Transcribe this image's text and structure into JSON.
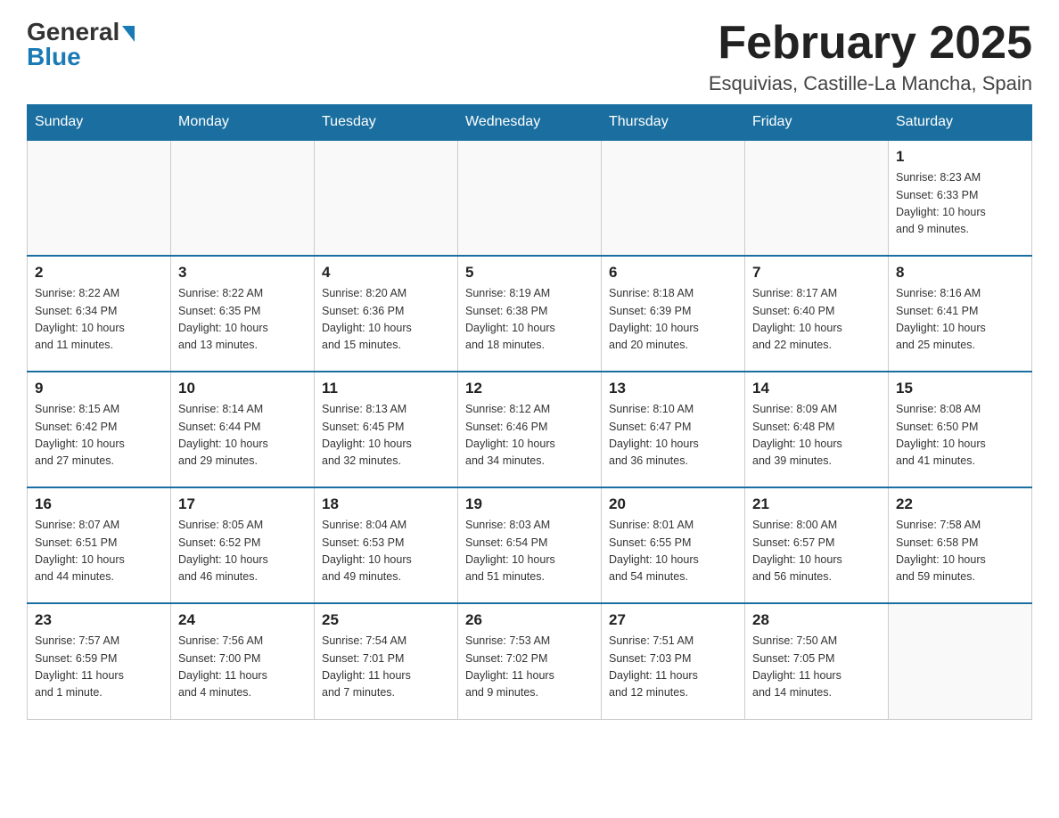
{
  "header": {
    "logo_general": "General",
    "logo_blue": "Blue",
    "month_title": "February 2025",
    "location": "Esquivias, Castille-La Mancha, Spain"
  },
  "weekdays": [
    "Sunday",
    "Monday",
    "Tuesday",
    "Wednesday",
    "Thursday",
    "Friday",
    "Saturday"
  ],
  "weeks": [
    [
      {
        "day": "",
        "info": ""
      },
      {
        "day": "",
        "info": ""
      },
      {
        "day": "",
        "info": ""
      },
      {
        "day": "",
        "info": ""
      },
      {
        "day": "",
        "info": ""
      },
      {
        "day": "",
        "info": ""
      },
      {
        "day": "1",
        "info": "Sunrise: 8:23 AM\nSunset: 6:33 PM\nDaylight: 10 hours\nand 9 minutes."
      }
    ],
    [
      {
        "day": "2",
        "info": "Sunrise: 8:22 AM\nSunset: 6:34 PM\nDaylight: 10 hours\nand 11 minutes."
      },
      {
        "day": "3",
        "info": "Sunrise: 8:22 AM\nSunset: 6:35 PM\nDaylight: 10 hours\nand 13 minutes."
      },
      {
        "day": "4",
        "info": "Sunrise: 8:20 AM\nSunset: 6:36 PM\nDaylight: 10 hours\nand 15 minutes."
      },
      {
        "day": "5",
        "info": "Sunrise: 8:19 AM\nSunset: 6:38 PM\nDaylight: 10 hours\nand 18 minutes."
      },
      {
        "day": "6",
        "info": "Sunrise: 8:18 AM\nSunset: 6:39 PM\nDaylight: 10 hours\nand 20 minutes."
      },
      {
        "day": "7",
        "info": "Sunrise: 8:17 AM\nSunset: 6:40 PM\nDaylight: 10 hours\nand 22 minutes."
      },
      {
        "day": "8",
        "info": "Sunrise: 8:16 AM\nSunset: 6:41 PM\nDaylight: 10 hours\nand 25 minutes."
      }
    ],
    [
      {
        "day": "9",
        "info": "Sunrise: 8:15 AM\nSunset: 6:42 PM\nDaylight: 10 hours\nand 27 minutes."
      },
      {
        "day": "10",
        "info": "Sunrise: 8:14 AM\nSunset: 6:44 PM\nDaylight: 10 hours\nand 29 minutes."
      },
      {
        "day": "11",
        "info": "Sunrise: 8:13 AM\nSunset: 6:45 PM\nDaylight: 10 hours\nand 32 minutes."
      },
      {
        "day": "12",
        "info": "Sunrise: 8:12 AM\nSunset: 6:46 PM\nDaylight: 10 hours\nand 34 minutes."
      },
      {
        "day": "13",
        "info": "Sunrise: 8:10 AM\nSunset: 6:47 PM\nDaylight: 10 hours\nand 36 minutes."
      },
      {
        "day": "14",
        "info": "Sunrise: 8:09 AM\nSunset: 6:48 PM\nDaylight: 10 hours\nand 39 minutes."
      },
      {
        "day": "15",
        "info": "Sunrise: 8:08 AM\nSunset: 6:50 PM\nDaylight: 10 hours\nand 41 minutes."
      }
    ],
    [
      {
        "day": "16",
        "info": "Sunrise: 8:07 AM\nSunset: 6:51 PM\nDaylight: 10 hours\nand 44 minutes."
      },
      {
        "day": "17",
        "info": "Sunrise: 8:05 AM\nSunset: 6:52 PM\nDaylight: 10 hours\nand 46 minutes."
      },
      {
        "day": "18",
        "info": "Sunrise: 8:04 AM\nSunset: 6:53 PM\nDaylight: 10 hours\nand 49 minutes."
      },
      {
        "day": "19",
        "info": "Sunrise: 8:03 AM\nSunset: 6:54 PM\nDaylight: 10 hours\nand 51 minutes."
      },
      {
        "day": "20",
        "info": "Sunrise: 8:01 AM\nSunset: 6:55 PM\nDaylight: 10 hours\nand 54 minutes."
      },
      {
        "day": "21",
        "info": "Sunrise: 8:00 AM\nSunset: 6:57 PM\nDaylight: 10 hours\nand 56 minutes."
      },
      {
        "day": "22",
        "info": "Sunrise: 7:58 AM\nSunset: 6:58 PM\nDaylight: 10 hours\nand 59 minutes."
      }
    ],
    [
      {
        "day": "23",
        "info": "Sunrise: 7:57 AM\nSunset: 6:59 PM\nDaylight: 11 hours\nand 1 minute."
      },
      {
        "day": "24",
        "info": "Sunrise: 7:56 AM\nSunset: 7:00 PM\nDaylight: 11 hours\nand 4 minutes."
      },
      {
        "day": "25",
        "info": "Sunrise: 7:54 AM\nSunset: 7:01 PM\nDaylight: 11 hours\nand 7 minutes."
      },
      {
        "day": "26",
        "info": "Sunrise: 7:53 AM\nSunset: 7:02 PM\nDaylight: 11 hours\nand 9 minutes."
      },
      {
        "day": "27",
        "info": "Sunrise: 7:51 AM\nSunset: 7:03 PM\nDaylight: 11 hours\nand 12 minutes."
      },
      {
        "day": "28",
        "info": "Sunrise: 7:50 AM\nSunset: 7:05 PM\nDaylight: 11 hours\nand 14 minutes."
      },
      {
        "day": "",
        "info": ""
      }
    ]
  ]
}
